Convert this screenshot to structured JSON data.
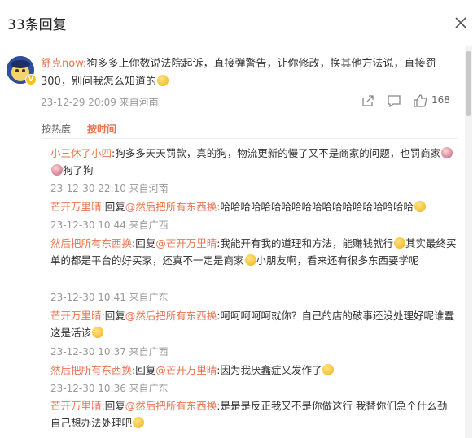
{
  "header": {
    "title": "33条回复",
    "close_icon": "close-icon"
  },
  "main_comment": {
    "author": "舒克now",
    "text_a": ":狗多多上你数说法院起诉，直接弹警告，让你修改，换其他方法说，直接罚300，别问我怎么知道的",
    "timestamp": "23-12-29 20:09 来自河南",
    "like_count": "168",
    "avatar_color": "#3d5fb8",
    "badge_label": "V"
  },
  "sort": {
    "hot_label": "按热度",
    "time_label": "按时间"
  },
  "replies": [
    {
      "author": "小三休了小四",
      "text": ":狗多多天天罚款，真的狗，物流更新的慢了又不是商家的问题，也罚商家",
      "text_after": "狗了狗",
      "timestamp": "23-12-30 22:10 来自河南"
    },
    {
      "author": "芒开万里晴",
      "reply_word": ":回复",
      "target": "@然后把所有东西换",
      "text": ":哈哈哈哈哈哈哈哈哈哈哈哈哈哈哈哈哈哈哈",
      "timestamp": "23-12-30 10:44 来自广西"
    },
    {
      "author": "然后把所有东西换",
      "reply_word": ":回复",
      "target": "@芒开万里晴",
      "text_a": ":我能开有我的道理和方法，能赚钱就行",
      "text_b": "其实最终买单的都是平台的好买家，还真不一定是商家",
      "text_c": "小朋友啊，看来还有很多东西要学呢",
      "timestamp": "23-12-30 10:41 来自广东"
    },
    {
      "author": "芒开万里晴",
      "reply_word": ":回复",
      "target": "@然后把所有东西换",
      "text": ":呵呵呵呵呵就你？自己的店的破事还没处理好呢谁蠢 这是活该",
      "timestamp": "23-12-30 10:37 来自广西"
    },
    {
      "author": "然后把所有东西换",
      "reply_word": ":回复",
      "target": "@芒开万里晴",
      "text": ":因为我厌蠢症又发作了",
      "timestamp": "23-12-30 10:36 来自广东"
    },
    {
      "author": "芒开万里晴",
      "reply_word": ":回复",
      "target": "@然后把所有东西换",
      "text": ":是是是反正我又不是你做这行 我替你们急个什么劲 自己想办法处理吧"
    }
  ]
}
